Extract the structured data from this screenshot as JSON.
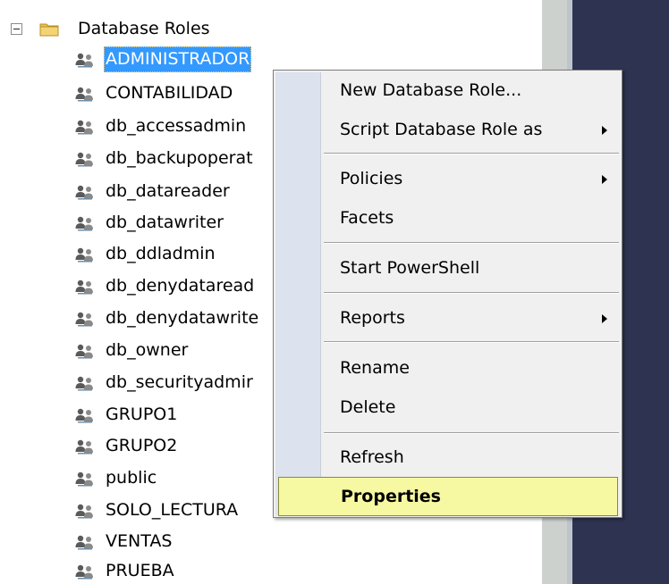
{
  "tree": {
    "root_label": "Database Roles",
    "roles": [
      "ADMINISTRADOR",
      "CONTABILIDAD",
      "db_accessadmin",
      "db_backupoperat",
      "db_datareader",
      "db_datawriter",
      "db_ddladmin",
      "db_denydataread",
      "db_denydatawrite",
      "db_owner",
      "db_securityadmir",
      "GRUPO1",
      "GRUPO2",
      "public",
      "SOLO_LECTURA",
      "VENTAS",
      "PRUEBA"
    ],
    "selected_role": "ADMINISTRADOR"
  },
  "context_menu": {
    "items": [
      {
        "label": "New Database Role...",
        "submenu": false
      },
      {
        "label": "Script Database Role as",
        "submenu": true
      },
      {
        "label": "Policies",
        "submenu": true
      },
      {
        "label": "Facets",
        "submenu": false
      },
      {
        "label": "Start PowerShell",
        "submenu": false
      },
      {
        "label": "Reports",
        "submenu": true
      },
      {
        "label": "Rename",
        "submenu": false
      },
      {
        "label": "Delete",
        "submenu": false
      },
      {
        "label": "Refresh",
        "submenu": false
      },
      {
        "label": "Properties",
        "submenu": false,
        "highlighted": true
      }
    ]
  },
  "colors": {
    "selection_bg": "#3399ff",
    "menu_highlight_bg": "#f6f9a1",
    "menu_bg": "#f0f0f0",
    "menu_gutter": "#dce3ee",
    "dark_pane": "#2d3350"
  },
  "icons": {
    "expander": "collapse-minus-icon",
    "root": "folder-icon",
    "role": "database-role-icon",
    "submenu": "submenu-arrow-icon"
  }
}
